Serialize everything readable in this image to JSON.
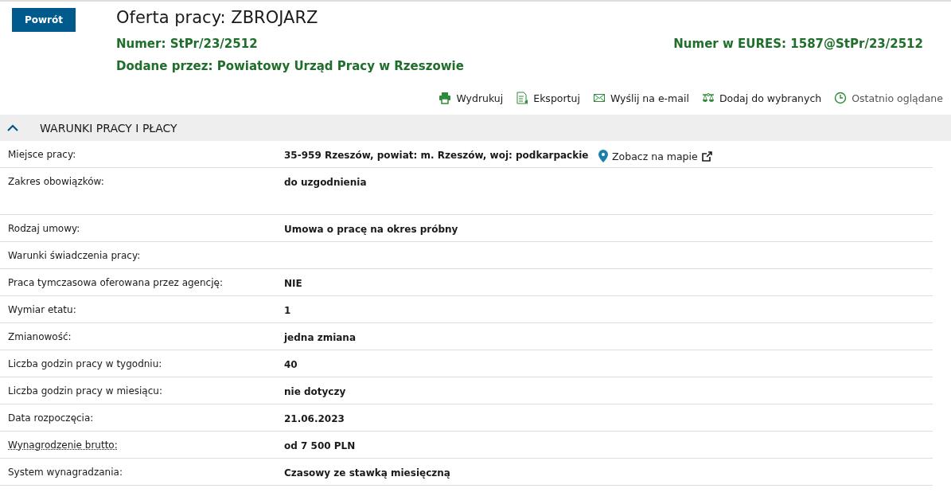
{
  "back_button": "Powrót",
  "title": "Oferta pracy: ZBROJARZ",
  "number": "Numer: StPr/23/2512",
  "eures_number": "Numer w EURES: 1587@StPr/23/2512",
  "added_by": "Dodane przez: Powiatowy Urząd Pracy w Rzeszowie",
  "actions": [
    {
      "kind": "print",
      "label": "Wydrukuj"
    },
    {
      "kind": "export",
      "label": "Eksportuj"
    },
    {
      "kind": "email",
      "label": "Wyślij na e-mail"
    },
    {
      "kind": "favorite",
      "label": "Dodaj do wybranych"
    },
    {
      "kind": "history",
      "label": "Ostatnio oglądane"
    }
  ],
  "section": {
    "title": "WARUNKI PRACY I PŁACY",
    "expanded": true,
    "rows": [
      {
        "label": "Miejsce pracy:",
        "value": "35-959 Rzeszów, powiat: m. Rzeszów, woj: podkarpackie",
        "map_link": "Zobacz na mapie",
        "underlined": false,
        "tall": false
      },
      {
        "label": "Zakres obowiązków:",
        "value": "do uzgodnienia",
        "underlined": false,
        "tall": true
      },
      {
        "label": "Rodzaj umowy:",
        "value": "Umowa o pracę na okres próbny",
        "underlined": false,
        "tall": false
      },
      {
        "label": "Warunki świadczenia pracy:",
        "underlined": false,
        "tall": false
      },
      {
        "label": "Praca tymczasowa oferowana przez agencję:",
        "value": "NIE",
        "underlined": false,
        "tall": false
      },
      {
        "label": "Wymiar etatu:",
        "value": "1",
        "underlined": false,
        "tall": false
      },
      {
        "label": "Zmianowość:",
        "value": "jedna zmiana",
        "underlined": false,
        "tall": false
      },
      {
        "label": "Liczba godzin pracy w tygodniu:",
        "value": "40",
        "underlined": false,
        "tall": false
      },
      {
        "label": "Liczba godzin pracy w miesiącu:",
        "value": "nie dotyczy",
        "underlined": false,
        "tall": false
      },
      {
        "label": "Data rozpoczęcia:",
        "value": "21.06.2023",
        "underlined": false,
        "tall": false
      },
      {
        "label": "Wynagrodzenie brutto:",
        "value": "od 7 500 PLN",
        "underlined": true,
        "tall": false
      },
      {
        "label": "System wynagradzania:",
        "value": "Czasowy ze stawką miesięczną",
        "underlined": false,
        "tall": false
      }
    ]
  }
}
